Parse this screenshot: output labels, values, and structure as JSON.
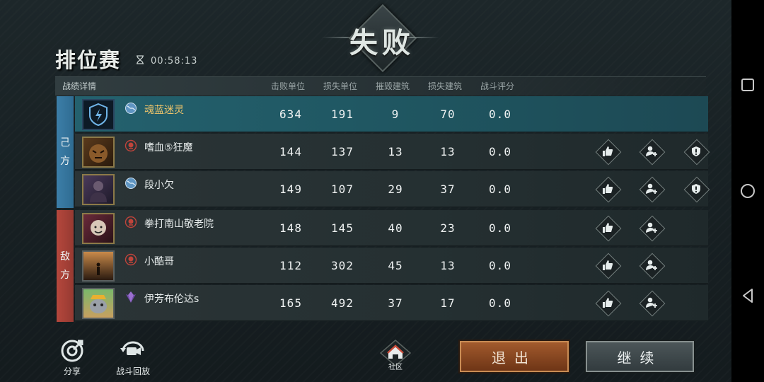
{
  "banner": {
    "result": "失败"
  },
  "header": {
    "title": "排位赛",
    "timer": "00:58:13"
  },
  "table": {
    "section_label": "战绩详情",
    "columns": [
      "击败单位",
      "损失单位",
      "摧毁建筑",
      "损失建筑",
      "战斗评分"
    ],
    "ally_label": [
      "己",
      "方"
    ],
    "enemy_label": [
      "敌",
      "方"
    ],
    "ally": [
      {
        "name": "魂蓝迷灵",
        "kills": "634",
        "losses": "191",
        "destroyed": "9",
        "lost_buildings": "70",
        "score": "0.0",
        "rank_icon": "globe-icon",
        "actions": []
      },
      {
        "name": "嗜血⑤狂魔",
        "kills": "144",
        "losses": "137",
        "destroyed": "13",
        "lost_buildings": "13",
        "score": "0.0",
        "rank_icon": "skull-icon",
        "actions": [
          "like",
          "add-friend",
          "report"
        ]
      },
      {
        "name": "段小欠",
        "kills": "149",
        "losses": "107",
        "destroyed": "29",
        "lost_buildings": "37",
        "score": "0.0",
        "rank_icon": "globe-icon",
        "actions": [
          "like",
          "add-friend",
          "report"
        ]
      }
    ],
    "enemy": [
      {
        "name": "拳打南山敬老院",
        "kills": "148",
        "losses": "145",
        "destroyed": "40",
        "lost_buildings": "23",
        "score": "0.0",
        "rank_icon": "skull-icon",
        "actions": [
          "like",
          "add-friend"
        ]
      },
      {
        "name": "小酷哥",
        "kills": "112",
        "losses": "302",
        "destroyed": "45",
        "lost_buildings": "13",
        "score": "0.0",
        "rank_icon": "skull-icon",
        "actions": [
          "like",
          "add-friend"
        ]
      },
      {
        "name": "伊芳布伦达s",
        "kills": "165",
        "losses": "492",
        "destroyed": "37",
        "lost_buildings": "17",
        "score": "0.0",
        "rank_icon": "crystal-icon",
        "actions": [
          "like",
          "add-friend"
        ]
      }
    ]
  },
  "footer": {
    "share": "分享",
    "replay": "战斗回放",
    "community": "社区",
    "exit": "退出",
    "continue": "继续"
  },
  "colors": {
    "ally": "#3c7ea8",
    "enemy": "#b5473c",
    "highlight_row": "#24616e",
    "name_highlight": "#f0c56b"
  }
}
